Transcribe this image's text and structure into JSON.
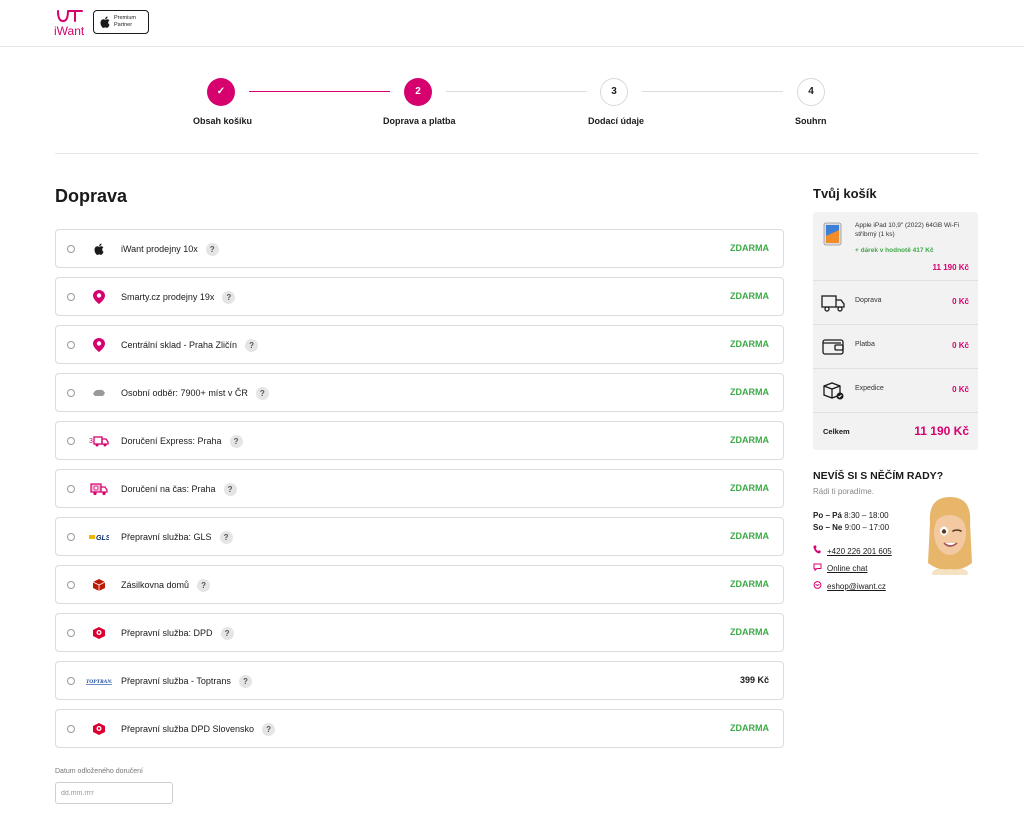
{
  "header": {
    "logo_text": "iWant",
    "partner_line1": "Premium",
    "partner_line2": "Partner"
  },
  "stepper": {
    "steps": [
      {
        "number": "✓",
        "label": "Obsah košíku"
      },
      {
        "number": "2",
        "label": "Doprava a platba"
      },
      {
        "number": "3",
        "label": "Dodací údaje"
      },
      {
        "number": "4",
        "label": "Souhrn"
      }
    ]
  },
  "main": {
    "title": "Doprava",
    "options": [
      {
        "name": "iWant prodejny 10x",
        "price": "ZDARMA",
        "icon": "apple-icon"
      },
      {
        "name": "Smarty.cz prodejny 19x",
        "price": "ZDARMA",
        "icon": "map-pin-icon"
      },
      {
        "name": "Centrální sklad - Praha Zličín",
        "price": "ZDARMA",
        "icon": "map-pin-icon"
      },
      {
        "name": "Osobní odběr: 7900+ míst v ČR",
        "price": "ZDARMA",
        "icon": "pickup-icon"
      },
      {
        "name": "Doručení Express: Praha",
        "price": "ZDARMA",
        "icon": "express-truck-icon"
      },
      {
        "name": "Doručení na čas: Praha",
        "price": "ZDARMA",
        "icon": "timed-truck-icon"
      },
      {
        "name": "Přepravní služba: GLS",
        "price": "ZDARMA",
        "icon": "gls-logo-icon"
      },
      {
        "name": "Zásilkovna domů",
        "price": "ZDARMA",
        "icon": "zasilkovna-icon"
      },
      {
        "name": "Přepravní služba: DPD",
        "price": "ZDARMA",
        "icon": "dpd-logo-icon"
      },
      {
        "name": "Přepravní služba - Toptrans",
        "price": "399 Kč",
        "icon": "toptrans-logo-icon"
      },
      {
        "name": "Přepravní služba DPD Slovensko",
        "price": "ZDARMA",
        "icon": "dpd-logo-icon"
      }
    ],
    "help_mark": "?",
    "date_label": "Datum odloženého doručení",
    "date_placeholder": "dd.mm.rrrr"
  },
  "cart": {
    "title": "Tvůj košík",
    "product_name": "Apple iPad 10,9\" (2022) 64GB Wi-Fi stříbrný (1 ks)",
    "gift": "+ dárek v hodnotě 417 Kč",
    "product_price": "11 190 Kč",
    "rows": [
      {
        "label": "Doprava",
        "value": "0 Kč",
        "icon": "truck-icon"
      },
      {
        "label": "Platba",
        "value": "0 Kč",
        "icon": "wallet-icon"
      },
      {
        "label": "Expedice",
        "value": "0 Kč",
        "icon": "package-icon"
      }
    ],
    "total_label": "Celkem",
    "total_value": "11 190 Kč"
  },
  "help": {
    "title": "NEVÍŠ SI S NĚČÍM RADY?",
    "subtitle": "Rádi ti poradíme.",
    "hours1_days": "Po – Pá",
    "hours1_time": "8:30 – 18:00",
    "hours2_days": "So – Ne",
    "hours2_time": "9:00 – 17:00",
    "phone": "+420 226 201 605",
    "chat": "Online chat",
    "email": "eshop@iwant.cz"
  },
  "colors": {
    "accent": "#d6006e",
    "free": "#3daa47"
  }
}
